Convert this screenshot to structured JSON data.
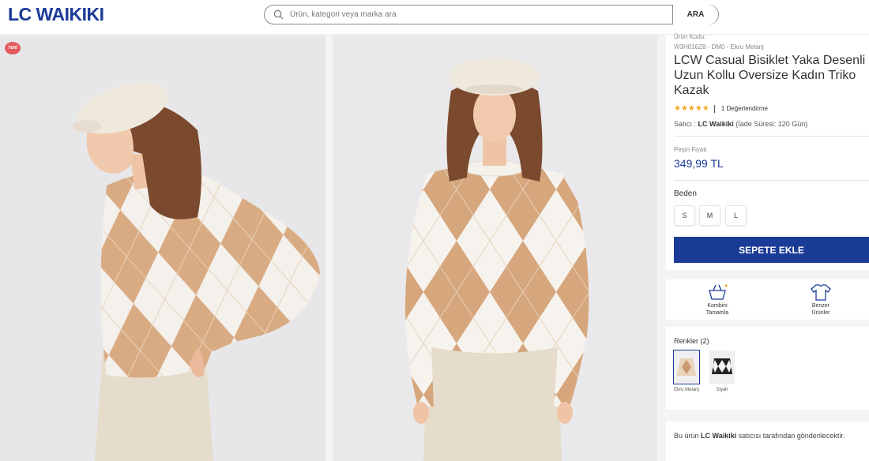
{
  "brand": {
    "logo_text": "LC WAIKIKI",
    "color": "#1a3b96"
  },
  "search": {
    "placeholder": "Ürün, kategori veya marka ara",
    "button_label": "ARA"
  },
  "gallery": {
    "badge_text": "YENİ"
  },
  "product": {
    "code_label": "Ürün Kodu:",
    "code_value": "W3H016Z8 - DM0 - Ekru Melanj",
    "title": "LCW Casual Bisiklet Yaka Desenli Uzun Kollu Oversize Kadın Triko Kazak",
    "stars": "★★★★★",
    "rating_count": "1 Değerlendirme",
    "seller_prefix": "Satıcı :",
    "seller_name": "LC Waikiki",
    "seller_suffix": "(İade Süresi: 120 Gün)",
    "price_label": "Peşin Fiyatı",
    "price": "349,99 TL",
    "size_label": "Beden",
    "sizes": [
      "S",
      "M",
      "L"
    ],
    "add_to_cart": "SEPETE EKLE",
    "combine_label": "Kombini Tamamla",
    "similar_label": "Benzer Ürünler",
    "colors_label": "Renkler (2)",
    "colors": [
      {
        "name": "Ekru Melanj",
        "selected": true
      },
      {
        "name": "Siyah",
        "selected": false
      }
    ],
    "shipping_prefix": "Bu ürün",
    "shipping_seller": "LC Waikiki",
    "shipping_suffix": "satıcısı tarafından gönderilecektir."
  }
}
